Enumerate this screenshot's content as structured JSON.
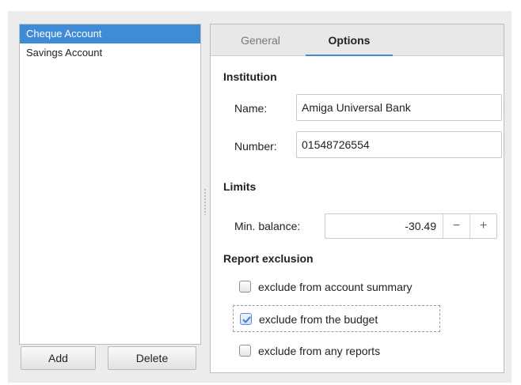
{
  "accounts": {
    "items": [
      {
        "label": "Cheque Account",
        "selected": true
      },
      {
        "label": "Savings Account",
        "selected": false
      }
    ],
    "add_label": "Add",
    "delete_label": "Delete"
  },
  "tabs": [
    {
      "label": "General",
      "active": false
    },
    {
      "label": "Options",
      "active": true
    }
  ],
  "institution": {
    "title": "Institution",
    "name_label": "Name:",
    "name_value": "Amiga Universal Bank",
    "number_label": "Number:",
    "number_value": "01548726554"
  },
  "limits": {
    "title": "Limits",
    "min_balance_label": "Min. balance:",
    "min_balance_value": "-30.49",
    "minus_symbol": "−",
    "plus_symbol": "+"
  },
  "report_exclusion": {
    "title": "Report exclusion",
    "options": [
      {
        "label": "exclude from account summary",
        "checked": false
      },
      {
        "label": "exclude from the budget",
        "checked": true
      },
      {
        "label": "exclude from any reports",
        "checked": false
      }
    ]
  },
  "colors": {
    "accent": "#3f8bd6",
    "selection_text": "#ffffff"
  }
}
